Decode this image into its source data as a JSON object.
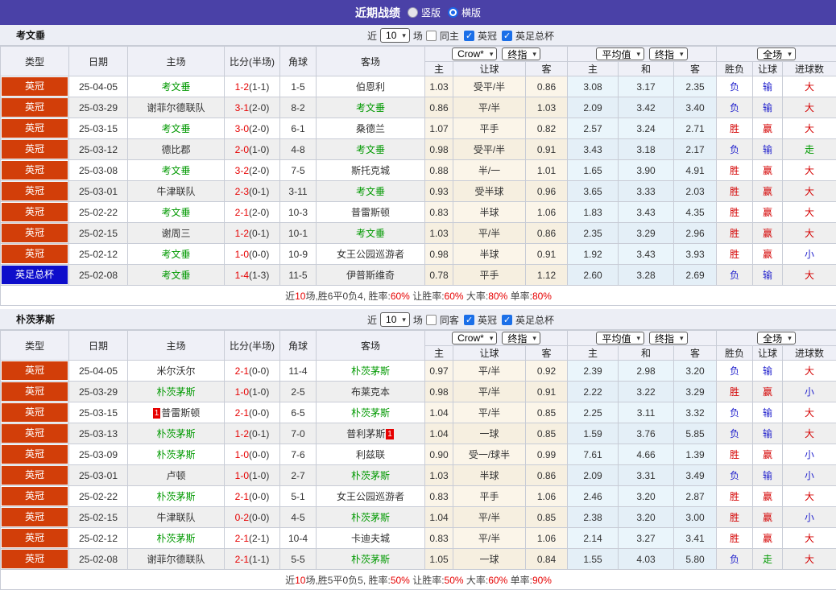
{
  "titlebar": {
    "title": "近期战绩",
    "vertical": "竖版",
    "horizontal": "横版"
  },
  "selects": {
    "count": "10",
    "odds_source": "Crow*",
    "final1": "终指",
    "avg": "平均值",
    "final2": "终指",
    "scope": "全场"
  },
  "columns": {
    "main": [
      "类型",
      "日期",
      "主场",
      "比分(半场)",
      "角球",
      "客场"
    ],
    "sub": [
      "主",
      "让球",
      "客",
      "主",
      "和",
      "客",
      "胜负",
      "让球",
      "进球数"
    ]
  },
  "colors": {
    "accent_purple": "#4A41A7",
    "league_badge": "#D23E09",
    "cup_badge": "#0D0DCB",
    "team_green": "#009900",
    "score_red": "#E60000",
    "result_red": "#D40000",
    "result_blue": "#1F1FCC",
    "result_green": "#009900",
    "handicap_col_bg": "#FBF5E9",
    "europe_col_bg": "#EAF5FB"
  },
  "result_color_map": {
    "胜": "red",
    "负": "blue",
    "赢": "red",
    "输": "blue",
    "大": "red",
    "小": "blue",
    "走": "green"
  },
  "tables": [
    {
      "team": "考文垂",
      "filter": {
        "prefix": "近",
        "suffix": "场",
        "same": "同主",
        "same_checked": false,
        "league": "英冠",
        "league_checked": true,
        "cup": "英足总杯",
        "cup_checked": true
      },
      "rows": [
        {
          "type": "英冠",
          "type_kind": "league",
          "date": "25-04-05",
          "home": "考文垂",
          "home_green": true,
          "score_ft": "1-2",
          "score_ht": "(1-1)",
          "corner": "1-5",
          "away": "伯恩利",
          "away_green": false,
          "hcp_home": "1.03",
          "hcp_line": "受平/半",
          "hcp_away": "0.86",
          "eu_home": "3.08",
          "eu_draw": "3.17",
          "eu_away": "2.35",
          "res_wl": "负",
          "res_hcp": "输",
          "res_goal": "大"
        },
        {
          "type": "英冠",
          "type_kind": "league",
          "date": "25-03-29",
          "home": "谢菲尔德联队",
          "home_green": false,
          "score_ft": "3-1",
          "score_ht": "(2-0)",
          "corner": "8-2",
          "away": "考文垂",
          "away_green": true,
          "hcp_home": "0.86",
          "hcp_line": "平/半",
          "hcp_away": "1.03",
          "eu_home": "2.09",
          "eu_draw": "3.42",
          "eu_away": "3.40",
          "res_wl": "负",
          "res_hcp": "输",
          "res_goal": "大"
        },
        {
          "type": "英冠",
          "type_kind": "league",
          "date": "25-03-15",
          "home": "考文垂",
          "home_green": true,
          "score_ft": "3-0",
          "score_ht": "(2-0)",
          "corner": "6-1",
          "away": "桑德兰",
          "away_green": false,
          "hcp_home": "1.07",
          "hcp_line": "平手",
          "hcp_away": "0.82",
          "eu_home": "2.57",
          "eu_draw": "3.24",
          "eu_away": "2.71",
          "res_wl": "胜",
          "res_hcp": "赢",
          "res_goal": "大"
        },
        {
          "type": "英冠",
          "type_kind": "league",
          "date": "25-03-12",
          "home": "德比郡",
          "home_green": false,
          "score_ft": "2-0",
          "score_ht": "(1-0)",
          "corner": "4-8",
          "away": "考文垂",
          "away_green": true,
          "hcp_home": "0.98",
          "hcp_line": "受平/半",
          "hcp_away": "0.91",
          "eu_home": "3.43",
          "eu_draw": "3.18",
          "eu_away": "2.17",
          "res_wl": "负",
          "res_hcp": "输",
          "res_goal": "走"
        },
        {
          "type": "英冠",
          "type_kind": "league",
          "date": "25-03-08",
          "home": "考文垂",
          "home_green": true,
          "score_ft": "3-2",
          "score_ht": "(2-0)",
          "corner": "7-5",
          "away": "斯托克城",
          "away_green": false,
          "hcp_home": "0.88",
          "hcp_line": "半/一",
          "hcp_away": "1.01",
          "eu_home": "1.65",
          "eu_draw": "3.90",
          "eu_away": "4.91",
          "res_wl": "胜",
          "res_hcp": "赢",
          "res_goal": "大"
        },
        {
          "type": "英冠",
          "type_kind": "league",
          "date": "25-03-01",
          "home": "牛津联队",
          "home_green": false,
          "score_ft": "2-3",
          "score_ht": "(0-1)",
          "corner": "3-11",
          "away": "考文垂",
          "away_green": true,
          "hcp_home": "0.93",
          "hcp_line": "受半球",
          "hcp_away": "0.96",
          "eu_home": "3.65",
          "eu_draw": "3.33",
          "eu_away": "2.03",
          "res_wl": "胜",
          "res_hcp": "赢",
          "res_goal": "大"
        },
        {
          "type": "英冠",
          "type_kind": "league",
          "date": "25-02-22",
          "home": "考文垂",
          "home_green": true,
          "score_ft": "2-1",
          "score_ht": "(2-0)",
          "corner": "10-3",
          "away": "普雷斯顿",
          "away_green": false,
          "hcp_home": "0.83",
          "hcp_line": "半球",
          "hcp_away": "1.06",
          "eu_home": "1.83",
          "eu_draw": "3.43",
          "eu_away": "4.35",
          "res_wl": "胜",
          "res_hcp": "赢",
          "res_goal": "大"
        },
        {
          "type": "英冠",
          "type_kind": "league",
          "date": "25-02-15",
          "home": "谢周三",
          "home_green": false,
          "score_ft": "1-2",
          "score_ht": "(0-1)",
          "corner": "10-1",
          "away": "考文垂",
          "away_green": true,
          "hcp_home": "1.03",
          "hcp_line": "平/半",
          "hcp_away": "0.86",
          "eu_home": "2.35",
          "eu_draw": "3.29",
          "eu_away": "2.96",
          "res_wl": "胜",
          "res_hcp": "赢",
          "res_goal": "大"
        },
        {
          "type": "英冠",
          "type_kind": "league",
          "date": "25-02-12",
          "home": "考文垂",
          "home_green": true,
          "score_ft": "1-0",
          "score_ht": "(0-0)",
          "corner": "10-9",
          "away": "女王公园巡游者",
          "away_green": false,
          "hcp_home": "0.98",
          "hcp_line": "半球",
          "hcp_away": "0.91",
          "eu_home": "1.92",
          "eu_draw": "3.43",
          "eu_away": "3.93",
          "res_wl": "胜",
          "res_hcp": "赢",
          "res_goal": "小"
        },
        {
          "type": "英足总杯",
          "type_kind": "cup",
          "date": "25-02-08",
          "home": "考文垂",
          "home_green": true,
          "score_ft": "1-4",
          "score_ht": "(1-3)",
          "corner": "11-5",
          "away": "伊普斯维奇",
          "away_green": false,
          "hcp_home": "0.78",
          "hcp_line": "平手",
          "hcp_away": "1.12",
          "eu_home": "2.60",
          "eu_draw": "3.28",
          "eu_away": "2.69",
          "res_wl": "负",
          "res_hcp": "输",
          "res_goal": "大"
        }
      ],
      "summary": [
        {
          "text": "近"
        },
        {
          "text": "10",
          "red": true
        },
        {
          "text": "场,胜6平0负4, 胜率:"
        },
        {
          "text": "60%",
          "red": true
        },
        {
          "text": " 让胜率:"
        },
        {
          "text": "60%",
          "red": true
        },
        {
          "text": " 大率:"
        },
        {
          "text": "80%",
          "red": true
        },
        {
          "text": " 单率:"
        },
        {
          "text": "80%",
          "red": true
        }
      ]
    },
    {
      "team": "朴茨茅斯",
      "filter": {
        "prefix": "近",
        "suffix": "场",
        "same": "同客",
        "same_checked": false,
        "league": "英冠",
        "league_checked": true,
        "cup": "英足总杯",
        "cup_checked": true
      },
      "rows": [
        {
          "type": "英冠",
          "type_kind": "league",
          "date": "25-04-05",
          "home": "米尔沃尔",
          "home_green": false,
          "score_ft": "2-1",
          "score_ht": "(0-0)",
          "corner": "11-4",
          "away": "朴茨茅斯",
          "away_green": true,
          "hcp_home": "0.97",
          "hcp_line": "平/半",
          "hcp_away": "0.92",
          "eu_home": "2.39",
          "eu_draw": "2.98",
          "eu_away": "3.20",
          "res_wl": "负",
          "res_hcp": "输",
          "res_goal": "大"
        },
        {
          "type": "英冠",
          "type_kind": "league",
          "date": "25-03-29",
          "home": "朴茨茅斯",
          "home_green": true,
          "score_ft": "1-0",
          "score_ht": "(1-0)",
          "corner": "2-5",
          "away": "布莱克本",
          "away_green": false,
          "hcp_home": "0.98",
          "hcp_line": "平/半",
          "hcp_away": "0.91",
          "eu_home": "2.22",
          "eu_draw": "3.22",
          "eu_away": "3.29",
          "res_wl": "胜",
          "res_hcp": "赢",
          "res_goal": "小"
        },
        {
          "type": "英冠",
          "type_kind": "league",
          "date": "25-03-15",
          "home": "普雷斯顿",
          "home_green": false,
          "home_card": "1",
          "score_ft": "2-1",
          "score_ht": "(0-0)",
          "corner": "6-5",
          "away": "朴茨茅斯",
          "away_green": true,
          "hcp_home": "1.04",
          "hcp_line": "平/半",
          "hcp_away": "0.85",
          "eu_home": "2.25",
          "eu_draw": "3.11",
          "eu_away": "3.32",
          "res_wl": "负",
          "res_hcp": "输",
          "res_goal": "大"
        },
        {
          "type": "英冠",
          "type_kind": "league",
          "date": "25-03-13",
          "home": "朴茨茅斯",
          "home_green": true,
          "score_ft": "1-2",
          "score_ht": "(0-1)",
          "corner": "7-0",
          "away": "普利茅斯",
          "away_green": false,
          "away_card": "1",
          "hcp_home": "1.04",
          "hcp_line": "一球",
          "hcp_away": "0.85",
          "eu_home": "1.59",
          "eu_draw": "3.76",
          "eu_away": "5.85",
          "res_wl": "负",
          "res_hcp": "输",
          "res_goal": "大"
        },
        {
          "type": "英冠",
          "type_kind": "league",
          "date": "25-03-09",
          "home": "朴茨茅斯",
          "home_green": true,
          "score_ft": "1-0",
          "score_ht": "(0-0)",
          "corner": "7-6",
          "away": "利兹联",
          "away_green": false,
          "hcp_home": "0.90",
          "hcp_line": "受一/球半",
          "hcp_away": "0.99",
          "eu_home": "7.61",
          "eu_draw": "4.66",
          "eu_away": "1.39",
          "res_wl": "胜",
          "res_hcp": "赢",
          "res_goal": "小"
        },
        {
          "type": "英冠",
          "type_kind": "league",
          "date": "25-03-01",
          "home": "卢顿",
          "home_green": false,
          "score_ft": "1-0",
          "score_ht": "(1-0)",
          "corner": "2-7",
          "away": "朴茨茅斯",
          "away_green": true,
          "hcp_home": "1.03",
          "hcp_line": "半球",
          "hcp_away": "0.86",
          "eu_home": "2.09",
          "eu_draw": "3.31",
          "eu_away": "3.49",
          "res_wl": "负",
          "res_hcp": "输",
          "res_goal": "小"
        },
        {
          "type": "英冠",
          "type_kind": "league",
          "date": "25-02-22",
          "home": "朴茨茅斯",
          "home_green": true,
          "score_ft": "2-1",
          "score_ht": "(0-0)",
          "corner": "5-1",
          "away": "女王公园巡游者",
          "away_green": false,
          "hcp_home": "0.83",
          "hcp_line": "平手",
          "hcp_away": "1.06",
          "eu_home": "2.46",
          "eu_draw": "3.20",
          "eu_away": "2.87",
          "res_wl": "胜",
          "res_hcp": "赢",
          "res_goal": "大"
        },
        {
          "type": "英冠",
          "type_kind": "league",
          "date": "25-02-15",
          "home": "牛津联队",
          "home_green": false,
          "score_ft": "0-2",
          "score_ht": "(0-0)",
          "corner": "4-5",
          "away": "朴茨茅斯",
          "away_green": true,
          "hcp_home": "1.04",
          "hcp_line": "平/半",
          "hcp_away": "0.85",
          "eu_home": "2.38",
          "eu_draw": "3.20",
          "eu_away": "3.00",
          "res_wl": "胜",
          "res_hcp": "赢",
          "res_goal": "小"
        },
        {
          "type": "英冠",
          "type_kind": "league",
          "date": "25-02-12",
          "home": "朴茨茅斯",
          "home_green": true,
          "score_ft": "2-1",
          "score_ht": "(2-1)",
          "corner": "10-4",
          "away": "卡迪夫城",
          "away_green": false,
          "hcp_home": "0.83",
          "hcp_line": "平/半",
          "hcp_away": "1.06",
          "eu_home": "2.14",
          "eu_draw": "3.27",
          "eu_away": "3.41",
          "res_wl": "胜",
          "res_hcp": "赢",
          "res_goal": "大"
        },
        {
          "type": "英冠",
          "type_kind": "league",
          "date": "25-02-08",
          "home": "谢菲尔德联队",
          "home_green": false,
          "score_ft": "2-1",
          "score_ht": "(1-1)",
          "corner": "5-5",
          "away": "朴茨茅斯",
          "away_green": true,
          "hcp_home": "1.05",
          "hcp_line": "一球",
          "hcp_away": "0.84",
          "eu_home": "1.55",
          "eu_draw": "4.03",
          "eu_away": "5.80",
          "res_wl": "负",
          "res_hcp": "走",
          "res_goal": "大"
        }
      ],
      "summary": [
        {
          "text": "近"
        },
        {
          "text": "10",
          "red": true
        },
        {
          "text": "场,胜5平0负5, 胜率:"
        },
        {
          "text": "50%",
          "red": true
        },
        {
          "text": " 让胜率:"
        },
        {
          "text": "50%",
          "red": true
        },
        {
          "text": " 大率:"
        },
        {
          "text": "60%",
          "red": true
        },
        {
          "text": " 单率:"
        },
        {
          "text": "90%",
          "red": true
        }
      ]
    }
  ]
}
